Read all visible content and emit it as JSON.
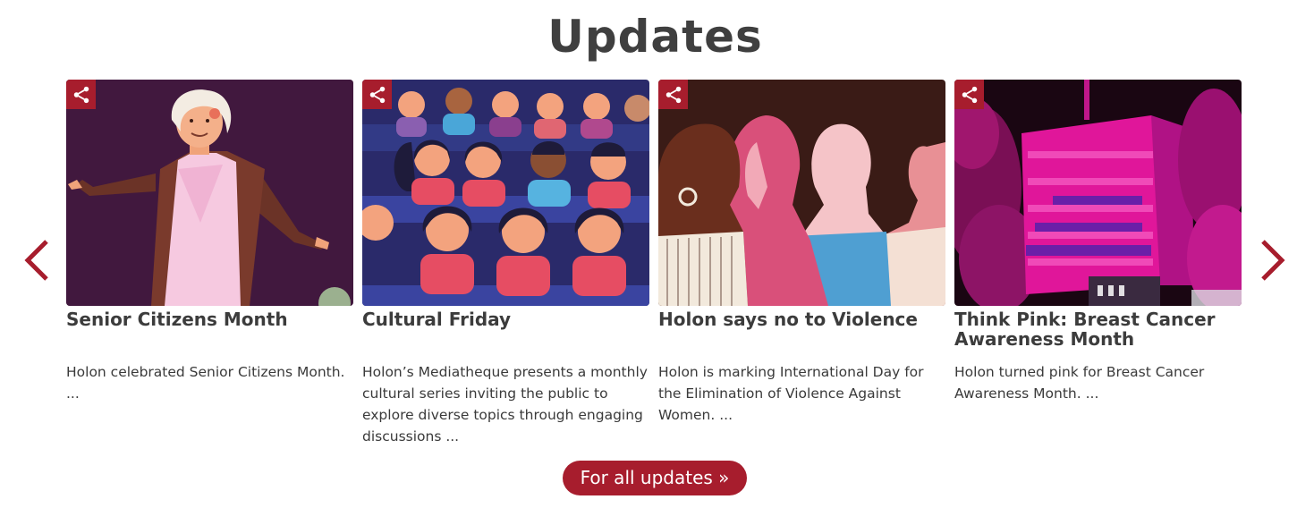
{
  "section": {
    "title": "Updates",
    "all_button_label": "For all updates »"
  },
  "colors": {
    "accent": "#a71d2d",
    "heading": "#3f3f3f",
    "text": "#3a3a3a"
  },
  "carousel": {
    "prev_icon": "chevron-left-icon",
    "next_icon": "chevron-right-icon",
    "cards": [
      {
        "title": "Senior Citizens Month",
        "excerpt": "Holon celebrated Senior Citizens Month. ...",
        "image": "illustration of elderly woman dancing",
        "share_icon": "share-icon"
      },
      {
        "title": "Cultural Friday",
        "excerpt": "Holon’s Mediatheque presents a monthly cultural series inviting the public to explore diverse topics through engaging discussions ...",
        "image": "illustration of smiling audience in theater",
        "share_icon": "share-icon"
      },
      {
        "title": "Holon says no to Violence",
        "excerpt": "Holon is marking International Day for the Elimination of Violence Against Women. ...",
        "image": "illustration of women silhouettes in profile",
        "share_icon": "share-icon"
      },
      {
        "title": "Think Pink: Breast Cancer Awareness Month",
        "excerpt": "Holon turned pink for Breast Cancer Awareness Month. ...",
        "image": "photo of building lit in pink at night",
        "share_icon": "share-icon"
      }
    ]
  }
}
